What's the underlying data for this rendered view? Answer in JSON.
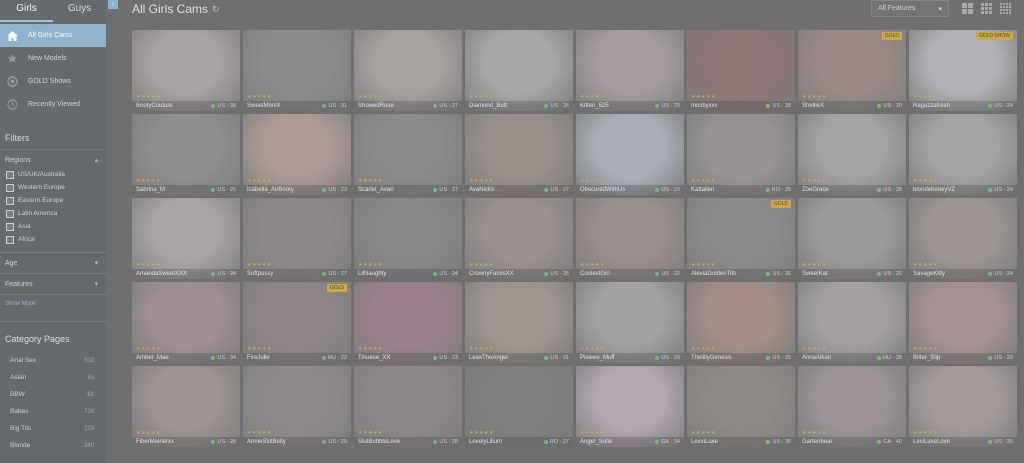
{
  "gender_tabs": [
    {
      "label": "Girls",
      "active": true
    },
    {
      "label": "Guys",
      "active": false
    }
  ],
  "collapse_icon": "chevron-left-icon",
  "nav": [
    {
      "label": "All Girls Cams",
      "icon": "home-icon",
      "active": true
    },
    {
      "label": "New Models",
      "icon": "star-icon",
      "active": false
    },
    {
      "label": "GOLD Shows",
      "icon": "gold-icon",
      "active": false
    },
    {
      "label": "Recently Viewed",
      "icon": "clock-icon",
      "active": false
    }
  ],
  "filters": {
    "title": "Filters",
    "regions_label": "Regions",
    "regions": [
      "US/UK/Australia",
      "Western Europe",
      "Eastern Europe",
      "Latin America",
      "Asia",
      "Africa"
    ],
    "age_label": "Age",
    "features_label": "Features",
    "show_more": "Show More"
  },
  "categories": {
    "title": "Category Pages",
    "items": [
      {
        "label": "Anal Sex",
        "count": "302"
      },
      {
        "label": "Asian",
        "count": "81"
      },
      {
        "label": "BBW",
        "count": "61"
      },
      {
        "label": "Babes",
        "count": "716"
      },
      {
        "label": "Big Tits",
        "count": "223"
      },
      {
        "label": "Blonde",
        "count": "340"
      }
    ]
  },
  "header": {
    "title": "All Girls Cams",
    "refresh_icon": "refresh-icon",
    "features_button": "All Features"
  },
  "view_icons": [
    "grid-large-icon",
    "grid-medium-icon",
    "grid-small-icon"
  ],
  "cards": [
    {
      "name": "BootyCouture",
      "country": "US",
      "age": "35",
      "badge": "",
      "bg": "#a9a2a2"
    },
    {
      "name": "SweetMoniX",
      "country": "US",
      "age": "31",
      "badge": "",
      "bg": "#8d8b8c"
    },
    {
      "name": "ShowedRose",
      "country": "US",
      "age": "27",
      "badge": "",
      "bg": "#a7a1a0"
    },
    {
      "name": "Diamond_Butt",
      "country": "US",
      "age": "26",
      "badge": "",
      "bg": "#a8a6a8"
    },
    {
      "name": "Kitten_525",
      "country": "US",
      "age": "29",
      "badge": "",
      "bg": "#a59c9e"
    },
    {
      "name": "mosbyxxx",
      "country": "US",
      "age": "28",
      "badge": "",
      "bg": "#8e7576"
    },
    {
      "name": "ShellieX",
      "country": "US",
      "age": "30",
      "badge": "GOLD",
      "bg": "#9b8a87"
    },
    {
      "name": "Ragazzafresh",
      "country": "US",
      "age": "24",
      "badge": "GOLD SHOW",
      "bg": "#b2b2b6"
    },
    {
      "name": "Sabrina_M",
      "country": "US",
      "age": "25",
      "badge": "",
      "bg": "#8f8e90"
    },
    {
      "name": "Isabella_AnBooty",
      "country": "US",
      "age": "23",
      "badge": "",
      "bg": "#ad9b95"
    },
    {
      "name": "Scarlet_Avari",
      "country": "US",
      "age": "27",
      "badge": "",
      "bg": "#8c8a8b"
    },
    {
      "name": "AvaNicks",
      "country": "US",
      "age": "27",
      "badge": "",
      "bg": "#9b8f8a"
    },
    {
      "name": "ObscuredWithUs",
      "country": "US",
      "age": "23",
      "badge": "",
      "bg": "#a9aeb8"
    },
    {
      "name": "Kattallen",
      "country": "RO",
      "age": "29",
      "badge": "",
      "bg": "#979394"
    },
    {
      "name": "ZoeGrace",
      "country": "US",
      "age": "28",
      "badge": "",
      "bg": "#a3a2a5"
    },
    {
      "name": "blondehoneyVZ",
      "country": "US",
      "age": "24",
      "badge": "",
      "bg": "#a4a3a4"
    },
    {
      "name": "AmandaSweetXXX",
      "country": "US",
      "age": "24",
      "badge": "",
      "bg": "#a8a3a5"
    },
    {
      "name": "Softpussy",
      "country": "US",
      "age": "27",
      "badge": "",
      "bg": "#8e8888"
    },
    {
      "name": "LilNaughty",
      "country": "US",
      "age": "24",
      "badge": "",
      "bg": "#888685"
    },
    {
      "name": "CrownyFacesXX",
      "country": "US",
      "age": "25",
      "badge": "",
      "bg": "#99908f"
    },
    {
      "name": "CoolestGirl",
      "country": "US",
      "age": "22",
      "badge": "",
      "bg": "#9a8f8d"
    },
    {
      "name": "AlexiaGoldenTits",
      "country": "US",
      "age": "26",
      "badge": "GOLD",
      "bg": "#8c8a8a"
    },
    {
      "name": "SweetKat",
      "country": "US",
      "age": "26",
      "badge": "",
      "bg": "#9c9a99"
    },
    {
      "name": "SavageKitty",
      "country": "US",
      "age": "24",
      "badge": "",
      "bg": "#9b9493"
    },
    {
      "name": "Amber_Mae",
      "country": "US",
      "age": "34",
      "badge": "",
      "bg": "#9f8f94"
    },
    {
      "name": "FireJulie",
      "country": "RU",
      "age": "22",
      "badge": "GOLD",
      "bg": "#8d8485"
    },
    {
      "name": "Tinuese_XX",
      "country": "US",
      "age": "23",
      "badge": "",
      "bg": "#9b7f8c"
    },
    {
      "name": "LeaxTheAngel",
      "country": "US",
      "age": "31",
      "badge": "",
      "bg": "#a0958d"
    },
    {
      "name": "Pixieee_Muff",
      "country": "US",
      "age": "29",
      "badge": "",
      "bg": "#a2a1a4"
    },
    {
      "name": "ThelillyGenesis",
      "country": "US",
      "age": "25",
      "badge": "",
      "bg": "#a48e87"
    },
    {
      "name": "AnnaAlkan",
      "country": "HU",
      "age": "28",
      "badge": "",
      "bg": "#a4a0a2"
    },
    {
      "name": "Bitter_Slip",
      "country": "US",
      "age": "23",
      "badge": "",
      "bg": "#a59193"
    },
    {
      "name": "FiberMeinerxx",
      "country": "US",
      "age": "28",
      "badge": "",
      "bg": "#9c9392"
    },
    {
      "name": "AnnieSlutBelly",
      "country": "US",
      "age": "29",
      "badge": "",
      "bg": "#8f8a8a"
    },
    {
      "name": "SlutBubbleLove",
      "country": "US",
      "age": "28",
      "badge": "",
      "bg": "#8c8687"
    },
    {
      "name": "LovelyLilium",
      "country": "RO",
      "age": "27",
      "badge": "",
      "bg": "#7f7e80"
    },
    {
      "name": "Angel_Sofie",
      "country": "GB",
      "age": "34",
      "badge": "",
      "bg": "#b3a6b1"
    },
    {
      "name": "LexxiLuxe",
      "country": "US",
      "age": "30",
      "badge": "",
      "bg": "#8f8987"
    },
    {
      "name": "Gartenbear",
      "country": "CA",
      "age": "40",
      "badge": "",
      "bg": "#9b9393"
    },
    {
      "name": "LexiLuxeLove",
      "country": "US",
      "age": "25",
      "badge": "",
      "bg": "#a39a9a"
    }
  ]
}
